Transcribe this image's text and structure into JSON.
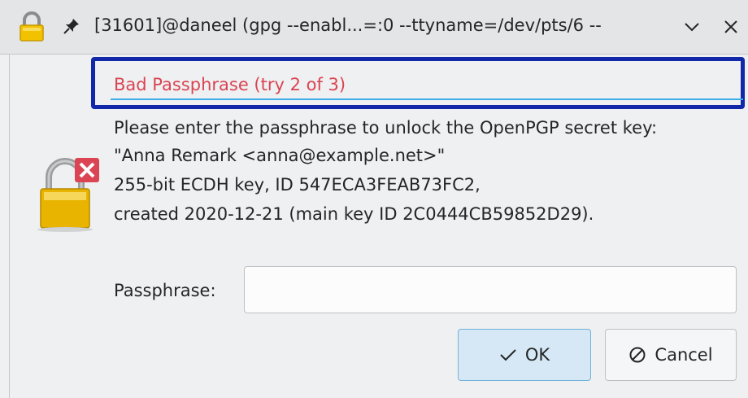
{
  "titlebar": {
    "title": "[31601]@daneel (gpg --enabl...=:0 --ttyname=/dev/pts/6 --",
    "app_icon": "lock-icon",
    "pin_icon": "pin-icon",
    "minimize_icon": "chevron-down-icon",
    "close_icon": "close-icon"
  },
  "dialog": {
    "error": "Bad Passphrase (try 2 of 3)",
    "description": [
      "Please enter the passphrase to unlock the OpenPGP secret key:",
      "\"Anna Remark <anna@example.net>\"",
      "255-bit ECDH key, ID 547ECA3FEAB73FC2,",
      "created 2020-12-21 (main key ID 2C0444CB59852D29)."
    ],
    "lock_icon": "lock-error-icon",
    "passphrase_label": "Passphrase:",
    "passphrase_value": "",
    "ok_label": "OK",
    "ok_icon": "checkmark-icon",
    "cancel_label": "Cancel",
    "cancel_icon": "cancel-icon"
  },
  "colors": {
    "error_text": "#da4453",
    "focus_frame": "#1128a8",
    "accent": "#3daee9",
    "ok_button_bg": "#d6e8f5"
  }
}
